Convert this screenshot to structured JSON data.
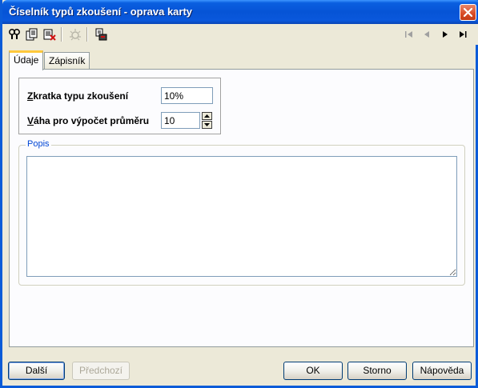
{
  "window": {
    "title": "Číselník typů zkoušení - oprava karty",
    "accent": "#0a5bd8"
  },
  "toolbar": {
    "buttons": [
      "find-icon",
      "copy-record-icon",
      "delete-record-icon",
      "disabled-tool-icon",
      "print-icon"
    ],
    "nav": [
      "first-record-icon",
      "previous-record-icon",
      "next-record-icon",
      "last-record-icon"
    ]
  },
  "tabs": [
    {
      "label": "Údaje",
      "active": true
    },
    {
      "label": "Zápisník",
      "active": false
    }
  ],
  "form": {
    "abbr_label_first": "Z",
    "abbr_label_rest": "kratka typu zkoušení",
    "abbr_value": "10%",
    "weight_label_first": "V",
    "weight_label_rest": "áha pro výpočet průměru",
    "weight_value": "10"
  },
  "description": {
    "group_title": "Popis",
    "value": ""
  },
  "buttons": {
    "next": "Další",
    "previous": "Předchozí",
    "ok": "OK",
    "cancel": "Storno",
    "help": "Nápověda"
  }
}
